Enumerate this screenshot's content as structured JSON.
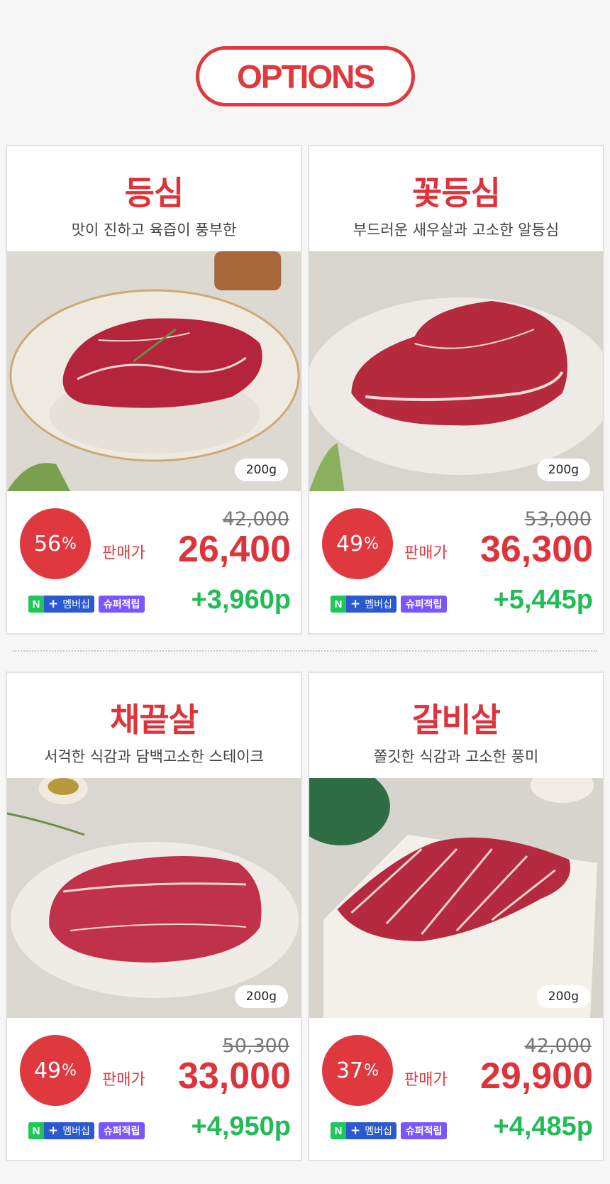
{
  "header": {
    "title": "OPTIONS"
  },
  "products": [
    {
      "name": "등심",
      "description": "맛이 진하고 육즙이 풍부한",
      "weight": "200g",
      "discount": "56",
      "percent_sign": "%",
      "original_price": "42,000",
      "sale_label": "판매가",
      "sale_price": "26,400",
      "points": "+3,960p"
    },
    {
      "name": "꽃등심",
      "description": "부드러운 새우살과 고소한 알등심",
      "weight": "200g",
      "discount": "49",
      "percent_sign": "%",
      "original_price": "53,000",
      "sale_label": "판매가",
      "sale_price": "36,300",
      "points": "+5,445p"
    },
    {
      "name": "채끝살",
      "description": "서걱한 식감과 담백고소한 스테이크",
      "weight": "200g",
      "discount": "49",
      "percent_sign": "%",
      "original_price": "50,300",
      "sale_label": "판매가",
      "sale_price": "33,000",
      "points": "+4,950p"
    },
    {
      "name": "갈비살",
      "description": "쫄깃한 식감과 고소한 풍미",
      "weight": "200g",
      "discount": "37",
      "percent_sign": "%",
      "original_price": "42,000",
      "sale_label": "판매가",
      "sale_price": "29,900",
      "points": "+4,485p"
    }
  ],
  "badges": {
    "naver_n": "N",
    "naver_plus": "+",
    "membership": "멤버십",
    "super_points": "슈퍼적립"
  },
  "colors": {
    "accent_red": "#e0383f",
    "points_green": "#22bb55",
    "naver_green": "#1fc75a",
    "naver_blue": "#2a59d0",
    "super_purple": "#7b55ff"
  }
}
